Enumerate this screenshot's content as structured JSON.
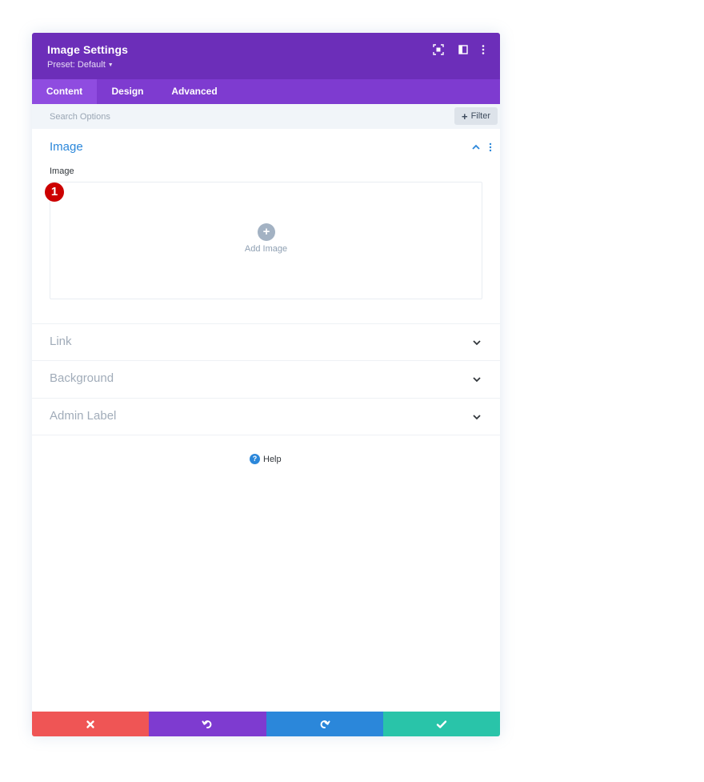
{
  "header": {
    "title": "Image Settings",
    "preset_label": "Preset: Default",
    "background": "#6c2eb9"
  },
  "tabs": [
    {
      "label": "Content",
      "active": true
    },
    {
      "label": "Design",
      "active": false
    },
    {
      "label": "Advanced",
      "active": false
    }
  ],
  "search": {
    "placeholder": "Search Options",
    "value": "",
    "filter_label": "Filter"
  },
  "image_section": {
    "title": "Image",
    "field_label": "Image",
    "add_label": "Add Image",
    "badge": "1"
  },
  "toggles": [
    {
      "label": "Link"
    },
    {
      "label": "Background"
    },
    {
      "label": "Admin Label"
    }
  ],
  "help": {
    "label": "Help",
    "glyph": "?"
  },
  "footer": {
    "cancel_color": "#ef5555",
    "undo_color": "#7e3bd0",
    "redo_color": "#2b87da",
    "save_color": "#29c4a9"
  }
}
